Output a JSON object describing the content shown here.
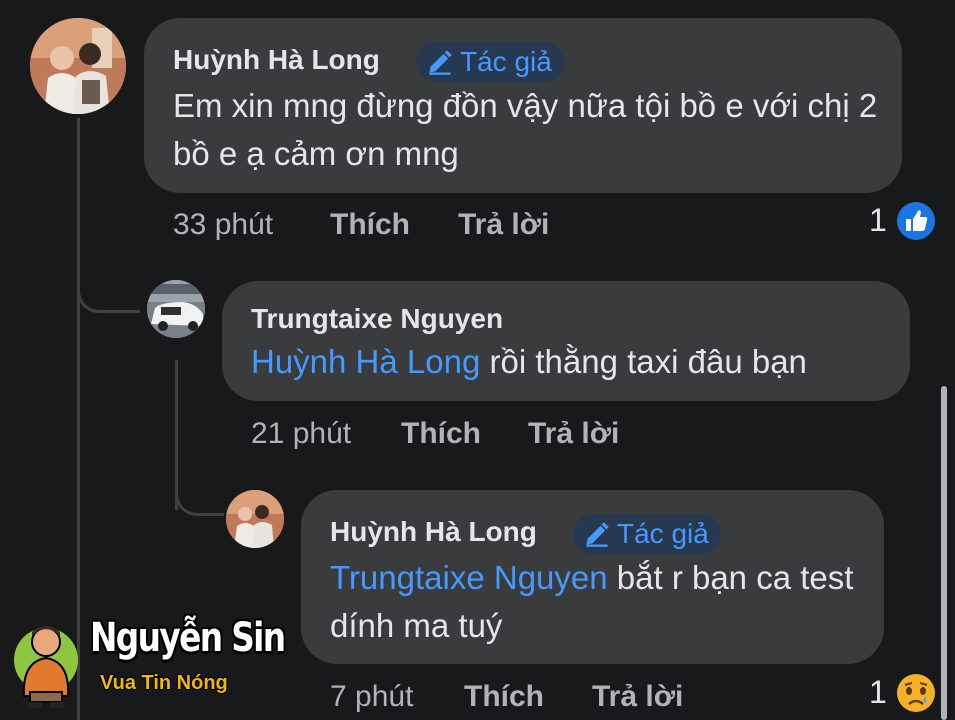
{
  "comment_1": {
    "author": "Huỳnh Hà Long",
    "badge": "Tác giả",
    "text": "Em xin mng đừng đồn vậy nữa tội bồ e với chị 2 bồ e ạ cảm ơn mng",
    "time": "33 phút",
    "like": "Thích",
    "reply": "Trả lời",
    "reaction_count": "1",
    "reaction_icon": "like-icon",
    "reaction_color": "#1b74e4"
  },
  "comment_2": {
    "author": "Trungtaixe Nguyen",
    "mention": "Huỳnh Hà Long",
    "text": " rồi thằng taxi đâu bạn",
    "time": "21 phút",
    "like": "Thích",
    "reply": "Trả lời"
  },
  "comment_3": {
    "author": "Huỳnh Hà Long",
    "badge": "Tác giả",
    "mention": "Trungtaixe Nguyen",
    "text": " bắt r bạn ca test dính ma tuý",
    "time": "7 phút",
    "like": "Thích",
    "reply": "Trả lời",
    "reaction_count": "1",
    "reaction_icon": "sad-icon",
    "reaction_color": "#f7b125"
  },
  "watermark": {
    "title": "Nguyễn Sin",
    "subtitle": "Vua Tin Nóng"
  },
  "colors": {
    "background": "#18191a",
    "bubble": "#3a3b3c",
    "link": "#4599ff",
    "meta": "#b0b3b8"
  }
}
